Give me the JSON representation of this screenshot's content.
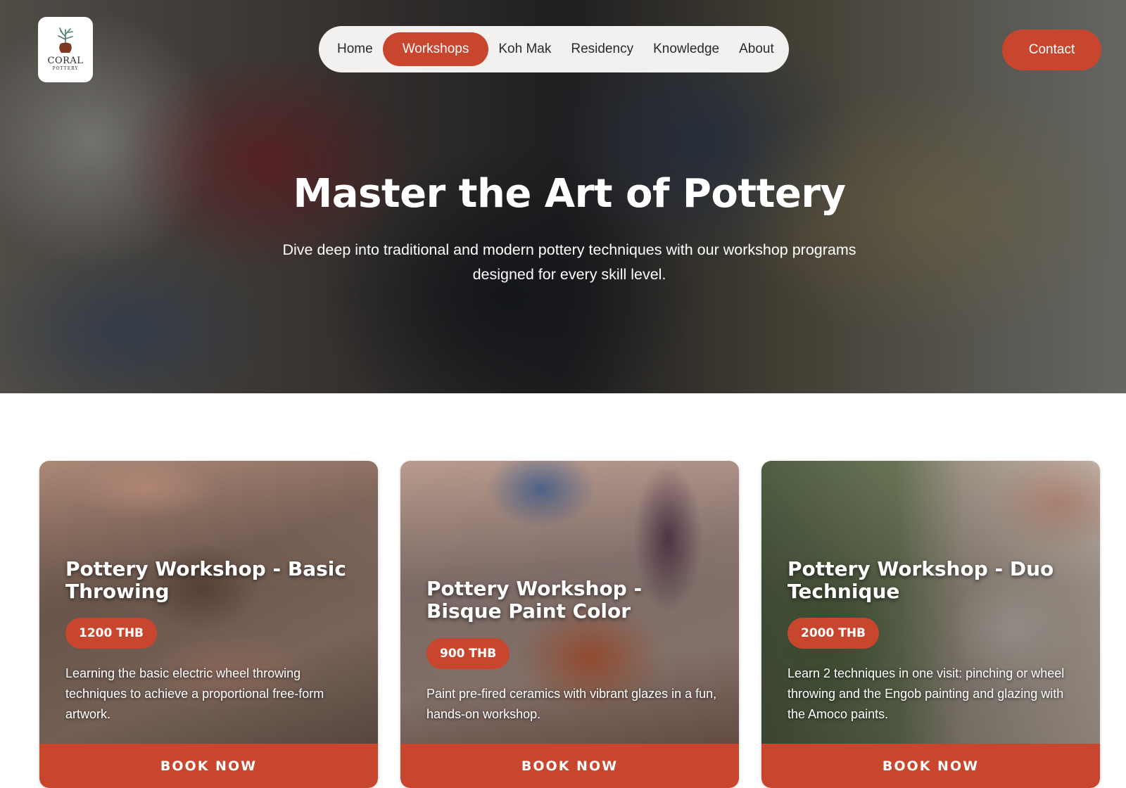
{
  "brand": {
    "logo_word": "CORAL",
    "logo_sub": "POTTERY"
  },
  "nav": {
    "items": [
      {
        "label": "Home",
        "active": false
      },
      {
        "label": "Workshops",
        "active": true
      },
      {
        "label": "Koh Mak",
        "active": false
      },
      {
        "label": "Residency",
        "active": false
      },
      {
        "label": "Knowledge",
        "active": false
      },
      {
        "label": "About",
        "active": false
      }
    ],
    "contact_label": "Contact"
  },
  "hero": {
    "title": "Master the Art of Pottery",
    "subtitle": "Dive deep into traditional and modern pottery techniques with our workshop programs designed for every skill level."
  },
  "workshops": [
    {
      "title": "Pottery Workshop - Basic Throwing",
      "price": "1200 THB",
      "description": "Learning the basic electric wheel throwing techniques to achieve a proportional free-form artwork.",
      "button_label": "BOOK NOW"
    },
    {
      "title": "Pottery Workshop - Bisque Paint Color",
      "price": "900 THB",
      "description": "Paint pre-fired ceramics with vibrant glazes in a fun, hands-on workshop.",
      "button_label": "BOOK NOW"
    },
    {
      "title": "Pottery Workshop - Duo Technique",
      "price": "2000 THB",
      "description": "Learn 2 techniques in one visit: pinching or wheel throwing and the Engob painting and glazing with the Amoco paints.",
      "button_label": "BOOK NOW"
    }
  ],
  "colors": {
    "accent": "#c8462e",
    "nav_bg": "#f2f1ef",
    "text_light": "#ffffff"
  }
}
